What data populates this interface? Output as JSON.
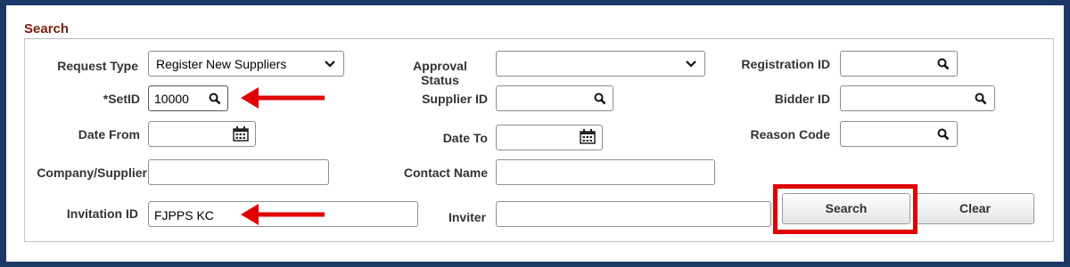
{
  "section": {
    "title": "Search"
  },
  "fields": {
    "request_type": {
      "label": "Request Type",
      "value": "Register New Suppliers"
    },
    "setid": {
      "label": "*SetID",
      "value": "10000"
    },
    "date_from": {
      "label": "Date From",
      "value": ""
    },
    "company_supplier": {
      "label": "Company/Supplier",
      "value": ""
    },
    "invitation_id": {
      "label": "Invitation ID",
      "value": "FJPPS KC"
    },
    "approval_status": {
      "label_line1": "Approval",
      "label_line2": "Status",
      "value": ""
    },
    "supplier_id": {
      "label": "Supplier ID",
      "value": ""
    },
    "date_to": {
      "label": "Date To",
      "value": ""
    },
    "contact_name": {
      "label": "Contact Name",
      "value": ""
    },
    "inviter": {
      "label": "Inviter",
      "value": ""
    },
    "registration_id": {
      "label": "Registration ID",
      "value": ""
    },
    "bidder_id": {
      "label": "Bidder ID",
      "value": ""
    },
    "reason_code": {
      "label": "Reason Code",
      "value": ""
    }
  },
  "buttons": {
    "search": "Search",
    "clear": "Clear"
  },
  "icons": {
    "lookup": "magnifier-icon",
    "calendar": "calendar-icon",
    "dropdown": "chevron-down-icon",
    "annotation": "red-arrow"
  },
  "colors": {
    "frame": "#1c3966",
    "section_title": "#7a1f12",
    "annotation": "#e00000"
  }
}
